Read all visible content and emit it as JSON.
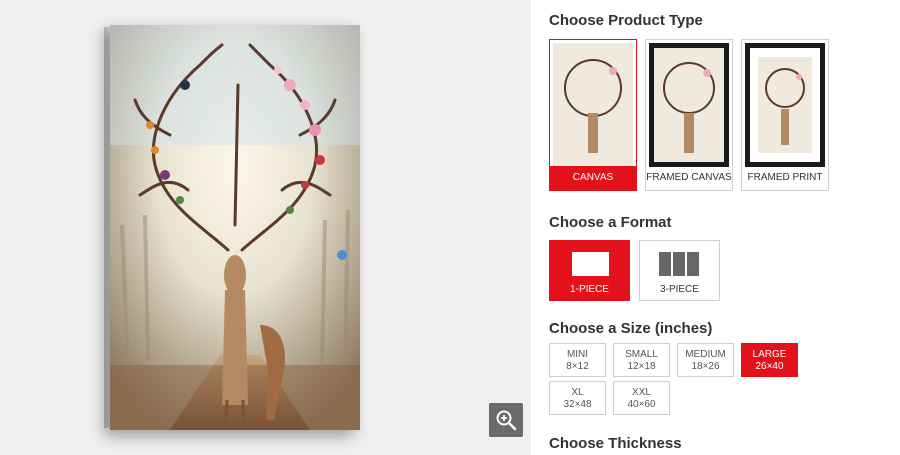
{
  "sections": {
    "product_type_title": "Choose Product Type",
    "format_title": "Choose a Format",
    "size_title": "Choose a Size (inches)",
    "thickness_title": "Choose Thickness"
  },
  "product_types": [
    {
      "label": "CANVAS",
      "selected": true
    },
    {
      "label": "FRAMED CANVAS",
      "selected": false
    },
    {
      "label": "FRAMED PRINT",
      "selected": false
    }
  ],
  "formats": [
    {
      "label": "1-PIECE",
      "selected": true
    },
    {
      "label": "3-PIECE",
      "selected": false
    }
  ],
  "sizes": [
    {
      "name": "MINI",
      "dims": "8×12",
      "selected": false
    },
    {
      "name": "SMALL",
      "dims": "12×18",
      "selected": false
    },
    {
      "name": "MEDIUM",
      "dims": "18×26",
      "selected": false
    },
    {
      "name": "LARGE",
      "dims": "26×40",
      "selected": true
    },
    {
      "name": "XL",
      "dims": "32×48",
      "selected": false
    },
    {
      "name": "XXL",
      "dims": "40×60",
      "selected": false
    }
  ],
  "colors": {
    "accent": "#e3121a",
    "border": "#cfcfcf",
    "preview_bg": "#f0f0f0"
  },
  "icons": {
    "zoom": "zoom-in-icon"
  }
}
